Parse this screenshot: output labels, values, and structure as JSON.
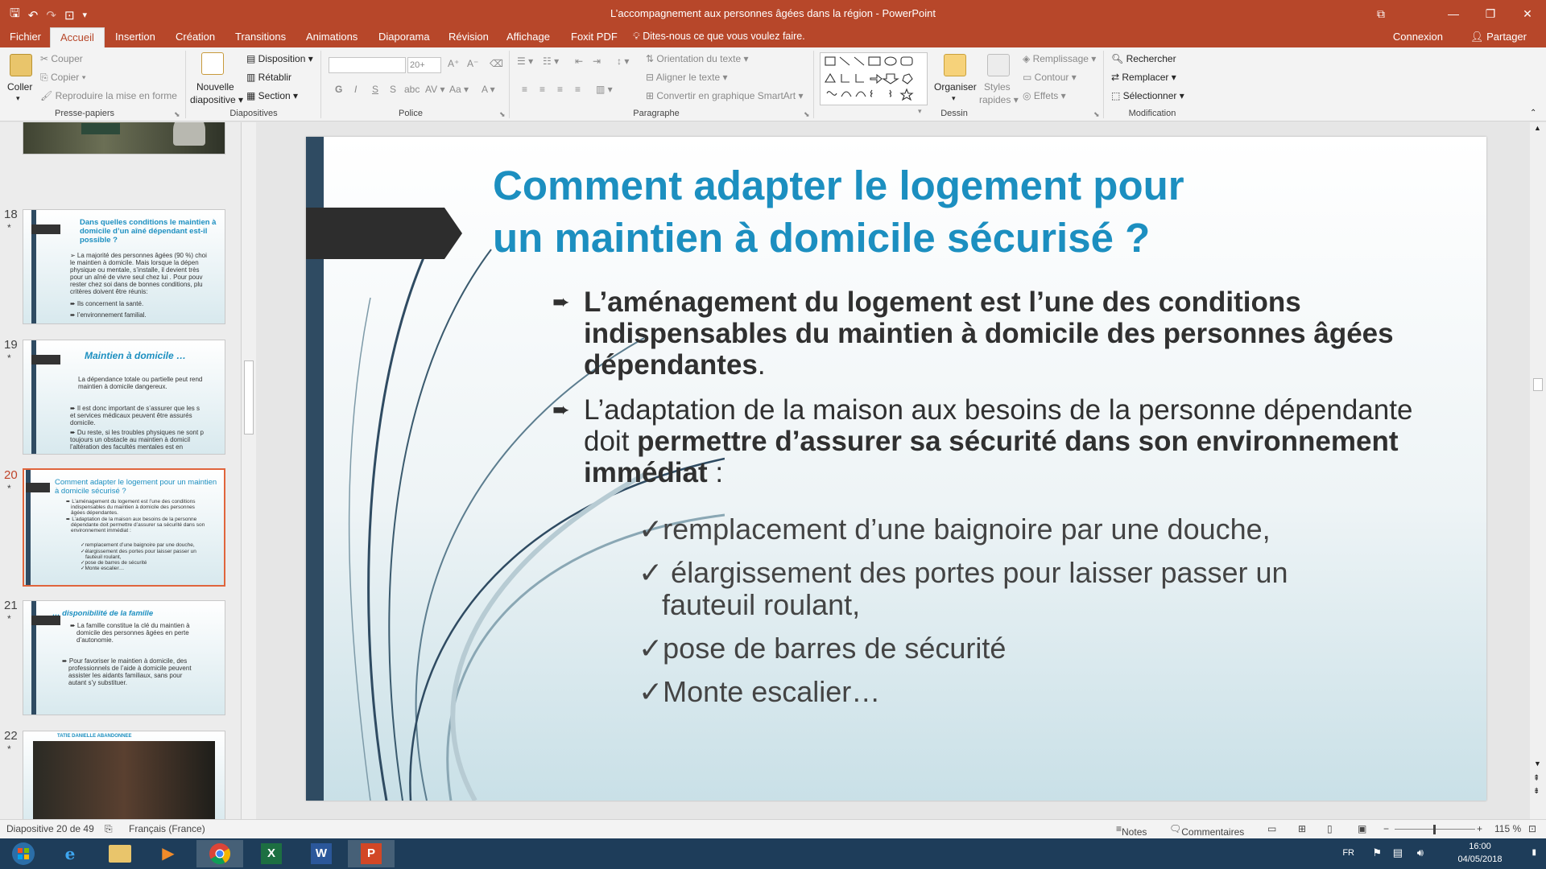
{
  "window": {
    "title": "L’accompagnement aux personnes âgées dans la région - PowerPoint"
  },
  "qat": {
    "save": "🖫",
    "undo": "↶",
    "redo": "↷",
    "present": "⊡",
    "customize": "▾"
  },
  "controls": {
    "ribbon_display": "⧉",
    "minimize": "—",
    "maximize": "❐",
    "close": "✕"
  },
  "tabs": [
    "Fichier",
    "Accueil",
    "Insertion",
    "Création",
    "Transitions",
    "Animations",
    "Diaporama",
    "Révision",
    "Affichage",
    "Foxit PDF"
  ],
  "tell_me": "Dites-nous ce que vous voulez faire.",
  "account": {
    "connexion": "Connexion",
    "share": "Partager"
  },
  "ribbon": {
    "clipboard": {
      "paste": "Coller",
      "cut": "Couper",
      "copy": "Copier",
      "format_painter": "Reproduire la mise en forme",
      "label": "Presse-papiers"
    },
    "slides": {
      "new": "Nouvelle",
      "new2": "diapositive",
      "layout": "Disposition",
      "reset": "Rétablir",
      "section": "Section",
      "label": "Diapositives"
    },
    "font": {
      "size": "20+",
      "label": "Police",
      "bold": "G",
      "italic": "I",
      "underline": "S"
    },
    "paragraph": {
      "text_direction": "Orientation du texte",
      "align_text": "Aligner le texte",
      "smartart": "Convertir en graphique SmartArt",
      "label": "Paragraphe"
    },
    "drawing": {
      "arrange": "Organiser",
      "styles": "Styles",
      "styles2": "rapides",
      "fill": "Remplissage",
      "outline": "Contour",
      "effects": "Effets",
      "label": "Dessin"
    },
    "editing": {
      "find": "Rechercher",
      "replace": "Remplacer",
      "select": "Sélectionner",
      "label": "Modification"
    }
  },
  "thumbnails": [
    {
      "num": "18",
      "title": "Dans quelles conditions le maintien à domicile d’un aîné dépendant est-il possible ?",
      "lines": [
        "➢ La majorité des personnes âgées (90 %) choi",
        "le maintien à domicile. Mais lorsque la dépen",
        "physique ou mentale, s’installe, il devient très",
        "pour un aîné de vivre seul chez lui . Pour pouv",
        "rester chez soi dans de bonnes conditions, plu",
        "critères doivent être réunis:",
        "➨ Ils concernent la santé.",
        "➨ l’environnement familial."
      ]
    },
    {
      "num": "19",
      "title": "Maintien à domicile …",
      "lines": [
        "La dépendance totale ou partielle  peut rend",
        "maintien à domicile dangereux.",
        "",
        "➨ Il est donc important de s’assurer que les s",
        "et services médicaux peuvent être assurés",
        "domicile.",
        "➨ Du reste, si les troubles physiques ne sont p",
        "toujours un obstacle au maintien à domicil",
        "l’altération des facultés mentales est en"
      ]
    },
    {
      "num": "20",
      "title": "Comment adapter le logement pour un maintien à domicile sécurisé ?",
      "lines": [
        "➨ L’aménagement du logement est l’une des conditions",
        "indispensables du maintien à domicile des personnes",
        "âgées dépendantes.",
        "➨ L’adaptation de la maison aux besoins de la personne",
        "dépendante doit permettre d’assurer sa sécurité dans son",
        "environnement immédiat :",
        "",
        "✓remplacement d’une baignoire par une douche,",
        "✓élargissement des portes pour laisser passer un",
        "fauteuil roulant,",
        "✓pose de barres de sécurité",
        "✓Monte escalier…"
      ]
    },
    {
      "num": "21",
      "title": "… disponibilité de la famille",
      "lines": [
        "➨ La famille constitue la clé du maintien à",
        "domicile des personnes âgées en perte",
        "d’autonomie.",
        "",
        "➨ Pour favoriser le maintien à domicile, des",
        "professionnels de l’aide à domicile peuvent",
        "assister les aidants familiaux, sans pour",
        "autant s’y substituer."
      ]
    },
    {
      "num": "22",
      "title": "TATIE DANIELLE ABANDONNEE",
      "lines": []
    }
  ],
  "slide": {
    "title_line1": "Comment adapter le logement pour",
    "title_line2": "un maintien à domicile sécurisé ?",
    "bullet1": "L’aménagement du logement est l’une des conditions indispensables du maintien à domicile des personnes âgées dépendantes",
    "bullet1_end": ".",
    "bullet2_normal": "L’adaptation de la maison aux besoins de la personne dépendante doit ",
    "bullet2_bold": "permettre d’assurer sa sécurité dans son environnement immédiat",
    "bullet2_end": " :",
    "checks": [
      "✓remplacement d’une baignoire par une douche,",
      "✓ élargissement des portes pour laisser passer un",
      "fauteuil roulant,",
      "✓pose de barres de sécurité",
      "✓Monte escalier…"
    ],
    "colors": {
      "title": "#1c8fc0",
      "bar": "#2f4b62",
      "text": "#303030"
    }
  },
  "status": {
    "slide_info": "Diapositive 20 de 49",
    "language": "Français (France)",
    "notes": "Notes",
    "comments": "Commentaires",
    "zoom": "115 %",
    "minus": "−",
    "plus": "+"
  },
  "taskbar": {
    "lang": "FR",
    "time": "16:00",
    "date": "04/05/2018"
  }
}
